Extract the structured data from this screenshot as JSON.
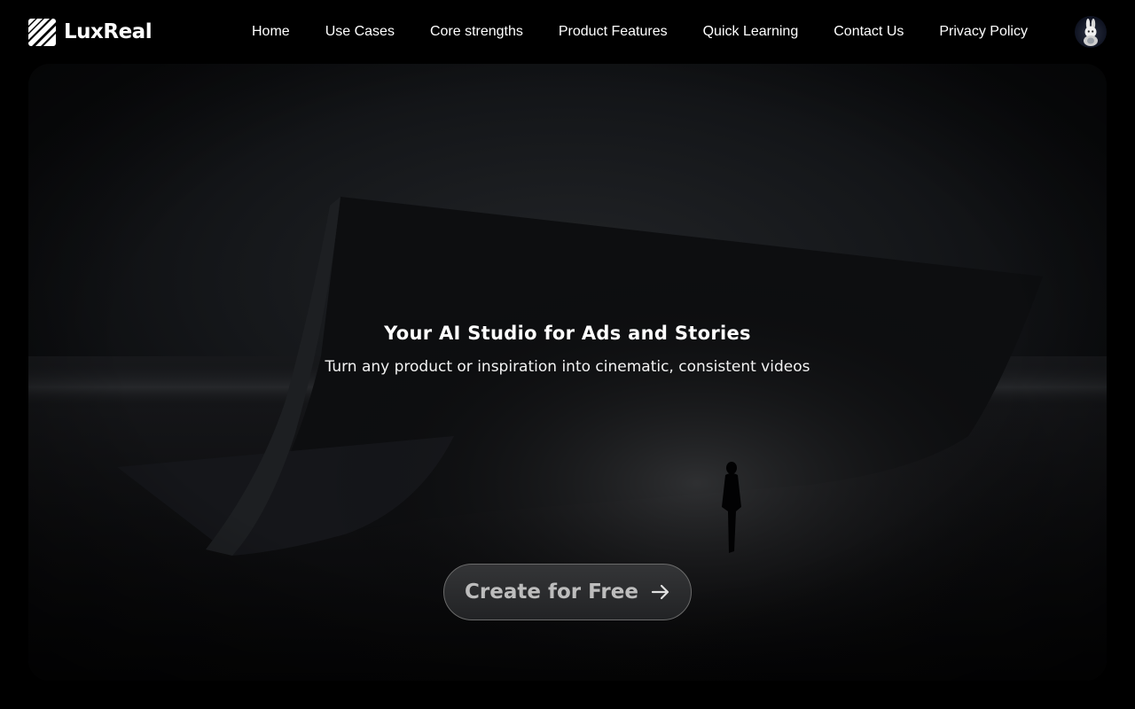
{
  "brand": {
    "name": "LuxReal",
    "logo_icon": "luxreal-logo-icon"
  },
  "nav": {
    "items": [
      {
        "label": "Home"
      },
      {
        "label": "Use Cases"
      },
      {
        "label": "Core strengths"
      },
      {
        "label": "Product Features"
      },
      {
        "label": "Quick Learning"
      },
      {
        "label": "Contact Us"
      },
      {
        "label": "Privacy Policy"
      }
    ]
  },
  "user": {
    "avatar_icon": "rabbit-avatar-icon"
  },
  "hero": {
    "title": "Your AI Studio for Ads and Stories",
    "subtitle": "Turn any product or inspiration into cinematic, consistent videos",
    "cta_label": "Create for Free",
    "cta_icon": "arrow-right-icon"
  },
  "colors": {
    "background": "#000000",
    "text": "#ffffff",
    "cta_text": "#bdbdbd",
    "cta_border": "#6a6a6a"
  }
}
